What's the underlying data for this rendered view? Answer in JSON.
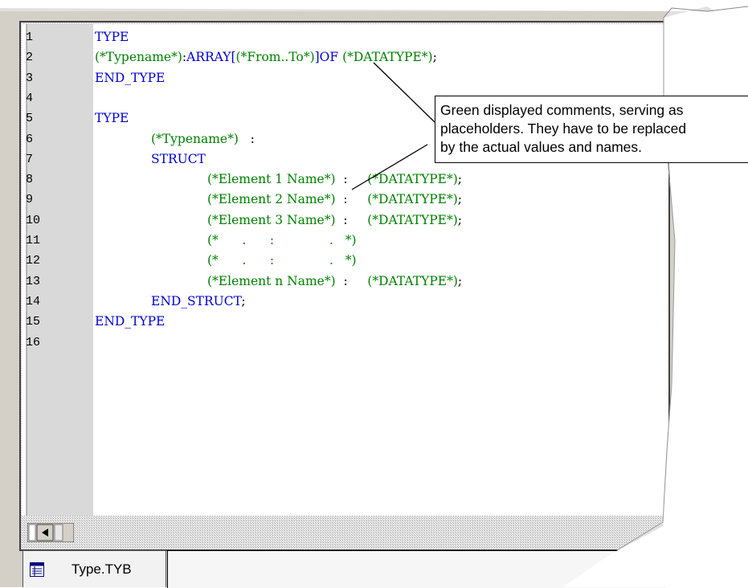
{
  "editor": {
    "lines": [
      {
        "n": "1",
        "indent": 0,
        "parts": [
          {
            "t": "TYPE",
            "c": "kw"
          }
        ]
      },
      {
        "n": "2",
        "indent": 0,
        "parts": [
          {
            "t": "(*Typename*)",
            "c": "cm"
          },
          {
            "t": ":",
            "c": "pl"
          },
          {
            "t": "ARRAY[",
            "c": "kw"
          },
          {
            "t": "(*From..To*)",
            "c": "cm"
          },
          {
            "t": "]OF ",
            "c": "kw"
          },
          {
            "t": "(*DATATYPE*)",
            "c": "cm"
          },
          {
            "t": ";",
            "c": "pl"
          }
        ]
      },
      {
        "n": "3",
        "indent": 0,
        "parts": [
          {
            "t": "END_TYPE",
            "c": "kw"
          }
        ]
      },
      {
        "n": "4",
        "indent": 0,
        "parts": []
      },
      {
        "n": "5",
        "indent": 0,
        "parts": [
          {
            "t": "TYPE",
            "c": "kw"
          }
        ]
      },
      {
        "n": "6",
        "indent": 1,
        "parts": [
          {
            "t": "(*Typename*)",
            "c": "cm"
          },
          {
            "t": "   :",
            "c": "pl"
          }
        ]
      },
      {
        "n": "7",
        "indent": 1,
        "parts": [
          {
            "t": "STRUCT",
            "c": "kw"
          }
        ]
      },
      {
        "n": "8",
        "indent": 2,
        "parts": [
          {
            "t": "(*Element 1 Name*)",
            "c": "cm"
          },
          {
            "t": "  :     ",
            "c": "pl"
          },
          {
            "t": "(*DATATYPE*)",
            "c": "cm"
          },
          {
            "t": ";",
            "c": "pl"
          }
        ]
      },
      {
        "n": "9",
        "indent": 2,
        "parts": [
          {
            "t": "(*Element 2 Name*)",
            "c": "cm"
          },
          {
            "t": "  :     ",
            "c": "pl"
          },
          {
            "t": "(*DATATYPE*)",
            "c": "cm"
          },
          {
            "t": ";",
            "c": "pl"
          }
        ]
      },
      {
        "n": "10",
        "indent": 2,
        "parts": [
          {
            "t": "(*Element 3 Name*)",
            "c": "cm"
          },
          {
            "t": "  :     ",
            "c": "pl"
          },
          {
            "t": "(*DATATYPE*)",
            "c": "cm"
          },
          {
            "t": ";",
            "c": "pl"
          }
        ]
      },
      {
        "n": "11",
        "indent": 2,
        "parts": [
          {
            "t": "(*      .      :              .   *)",
            "c": "cm"
          }
        ]
      },
      {
        "n": "12",
        "indent": 2,
        "parts": [
          {
            "t": "(*      .      :              .   *)",
            "c": "cm"
          }
        ]
      },
      {
        "n": "13",
        "indent": 2,
        "parts": [
          {
            "t": "(*Element n Name*)",
            "c": "cm"
          },
          {
            "t": "  :     ",
            "c": "pl"
          },
          {
            "t": "(*DATATYPE*)",
            "c": "cm"
          },
          {
            "t": ";",
            "c": "pl"
          }
        ]
      },
      {
        "n": "14",
        "indent": 1,
        "parts": [
          {
            "t": "END_STRUCT",
            "c": "kw"
          },
          {
            "t": ";",
            "c": "pl"
          }
        ]
      },
      {
        "n": "15",
        "indent": 0,
        "parts": [
          {
            "t": "END_TYPE",
            "c": "kw"
          }
        ]
      },
      {
        "n": "16",
        "indent": 0,
        "parts": []
      }
    ]
  },
  "callout": {
    "lines": [
      "Green displayed comments, serving as",
      "placeholders. They have to be replaced",
      "by the actual values and names."
    ]
  },
  "tab": {
    "label": "Type.TYB",
    "icon": "document-list-icon"
  },
  "colors": {
    "keyword": "#0000d0",
    "comment": "#008000",
    "editor_bg": "#ffffff",
    "gutter_bg": "#d4d4d4"
  }
}
